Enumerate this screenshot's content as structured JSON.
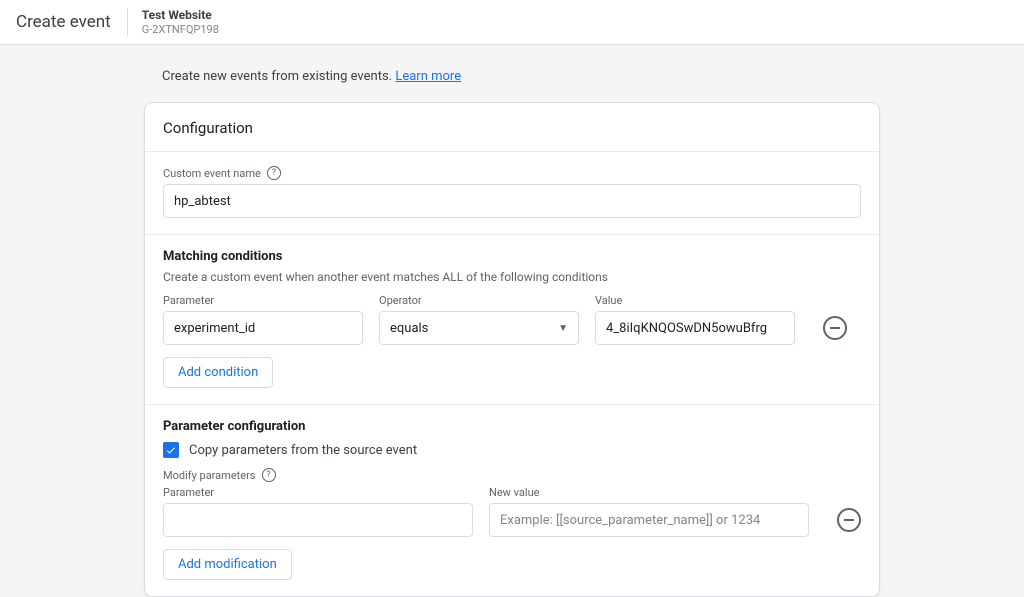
{
  "header": {
    "page_title": "Create event",
    "site_name": "Test Website",
    "site_id": "G-2XTNFQP198"
  },
  "intro": {
    "text": "Create new events from existing events.",
    "link_label": "Learn more"
  },
  "card": {
    "title": "Configuration",
    "custom_name": {
      "label": "Custom event name",
      "value": "hp_abtest"
    },
    "matching": {
      "title": "Matching conditions",
      "desc": "Create a custom event when another event matches ALL of the following conditions",
      "param_label": "Parameter",
      "operator_label": "Operator",
      "value_label": "Value",
      "row": {
        "parameter": "experiment_id",
        "operator": "equals",
        "value": "4_8iIqKNQOSwDN5owuBfrg"
      },
      "add_btn": "Add condition"
    },
    "paramcfg": {
      "title": "Parameter configuration",
      "copy_label": "Copy parameters from the source event",
      "modify_label": "Modify parameters",
      "param_label": "Parameter",
      "newval_label": "New value",
      "newval_placeholder": "Example: [[source_parameter_name]] or 1234",
      "add_btn": "Add modification"
    }
  }
}
